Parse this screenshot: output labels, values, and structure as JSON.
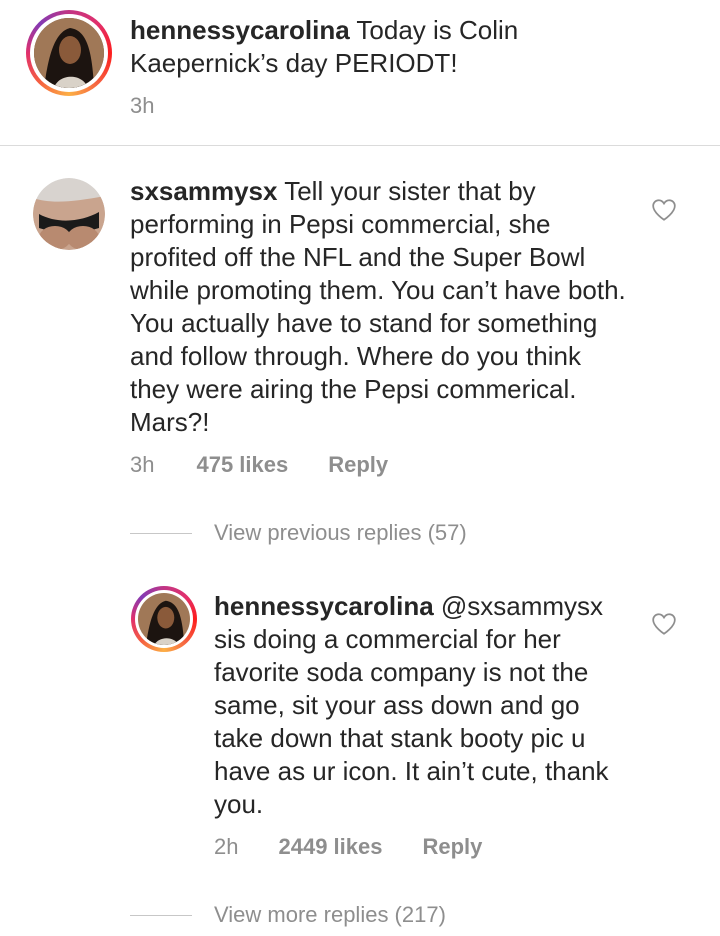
{
  "caption": {
    "username": "hennessycarolina",
    "text": " Today is Colin Kaepernick’s day PERIODT!",
    "time": "3h"
  },
  "comment": {
    "username": "sxsammysx",
    "text": " Tell your sister that by performing in Pepsi commercial, she profited off the NFL and the Super Bowl while promoting them. You can’t have both. You actually have to stand for something and follow through. Where do you think they were airing the Pepsi commerical. Mars?!",
    "time": "3h",
    "likes": "475 likes",
    "reply_label": "Reply",
    "view_previous": "View previous replies (57)"
  },
  "reply": {
    "username": "hennessycarolina",
    "mention": " @sxsammysx",
    "text": "sis doing a commercial for her favorite soda company is not the same, sit your ass down and go take down that stank booty pic u have as ur icon. It ain’t cute, thank you.",
    "time": "2h",
    "likes": "2449 likes",
    "reply_label": "Reply",
    "view_more": "View more replies (217)"
  },
  "icons": {
    "heart": "heart-outline-icon"
  },
  "colors": {
    "text": "#262626",
    "muted": "#8e8e8e",
    "divider": "#dbdbdb"
  }
}
